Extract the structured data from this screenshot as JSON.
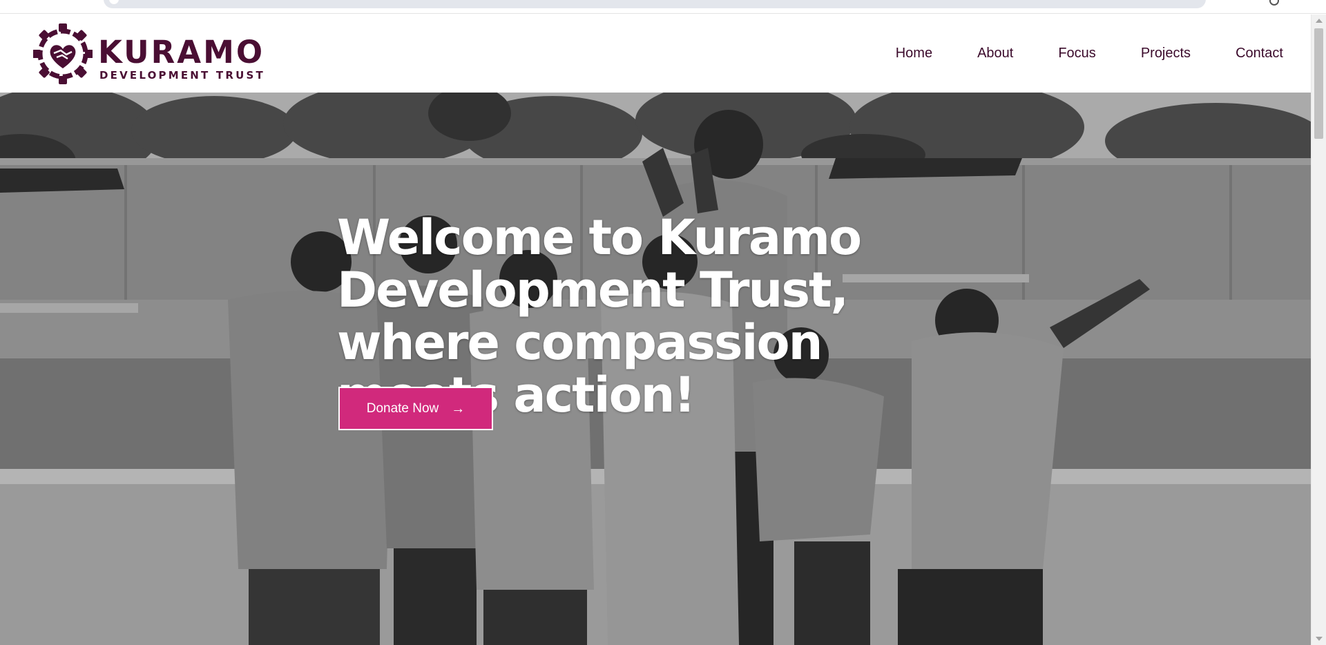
{
  "header": {
    "logo_title": "KURAMO",
    "logo_subtitle": "DEVELOPMENT TRUST",
    "nav": [
      {
        "label": "Home"
      },
      {
        "label": "About"
      },
      {
        "label": "Focus"
      },
      {
        "label": "Projects"
      },
      {
        "label": "Contact"
      }
    ]
  },
  "hero": {
    "title": "Welcome to Kuramo Development Trust, where compassion meets action!",
    "cta_label": "Donate Now",
    "cta_icon": "arrow-right-icon",
    "image": "black-and-white-group-photo-of-children"
  },
  "colors": {
    "brand": "#4a0e33",
    "accent": "#d1297c",
    "nav_text": "#3b0a2b"
  }
}
